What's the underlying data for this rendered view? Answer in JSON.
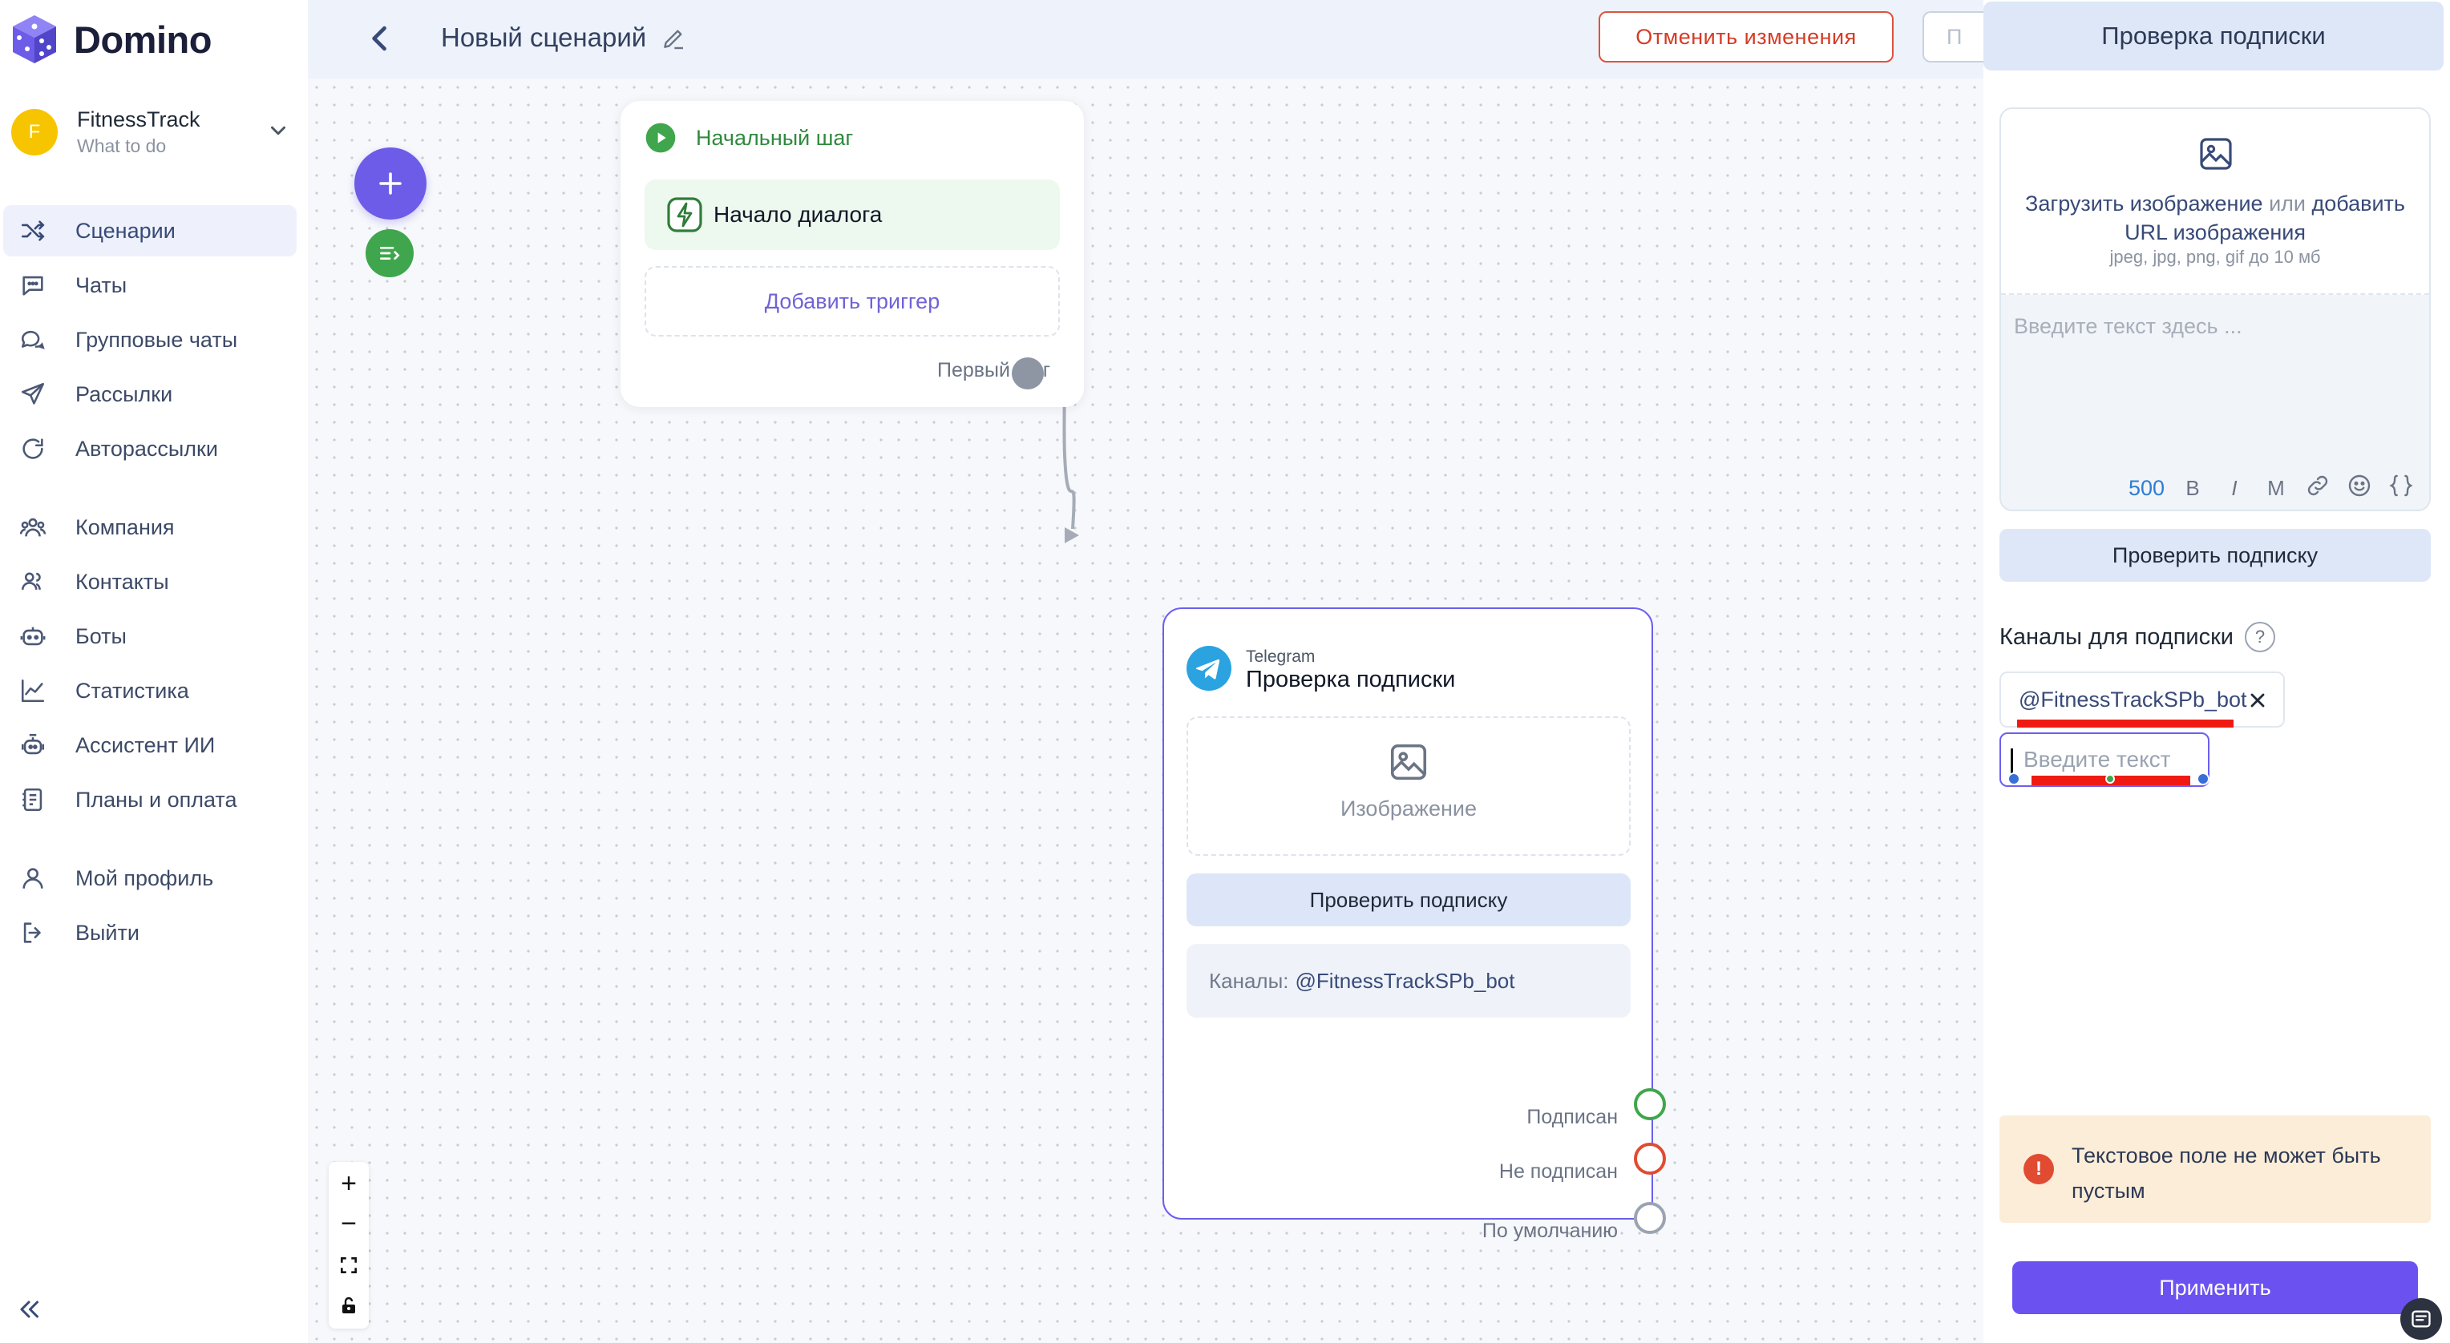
{
  "brand": {
    "name": "Domino",
    "logo_icon": "dice-cube-icon",
    "color": "#6c5ce7"
  },
  "workspace": {
    "avatar_letter": "F",
    "name": "FitnessTrack",
    "subtitle": "What to do"
  },
  "sidebar": {
    "items": [
      {
        "label": "Сценарии",
        "icon": "shuffle-icon",
        "active": true
      },
      {
        "label": "Чаты",
        "icon": "chat-icon"
      },
      {
        "label": "Групповые чаты",
        "icon": "group-chat-icon"
      },
      {
        "label": "Рассылки",
        "icon": "send-icon"
      },
      {
        "label": "Авторассылки",
        "icon": "auto-mail-icon"
      },
      {
        "label": "Компания",
        "icon": "company-icon"
      },
      {
        "label": "Контакты",
        "icon": "contacts-icon"
      },
      {
        "label": "Боты",
        "icon": "bot-icon"
      },
      {
        "label": "Статистика",
        "icon": "stats-icon"
      },
      {
        "label": "Ассистент ИИ",
        "icon": "ai-assistant-icon"
      },
      {
        "label": "Планы и оплата",
        "icon": "billing-icon"
      },
      {
        "label": "Мой профиль",
        "icon": "user-icon"
      },
      {
        "label": "Выйти",
        "icon": "logout-icon"
      }
    ]
  },
  "header": {
    "title": "Новый сценарий",
    "cancel_label": "Отменить изменения",
    "cut_label": "П"
  },
  "canvas": {
    "start_node": {
      "title": "Начальный шаг",
      "trigger_label": "Начало диалога",
      "add_trigger_label": "Добавить триггер",
      "output_label": "Первый шаг"
    },
    "check_node": {
      "platform": "Telegram",
      "title": "Проверка подписки",
      "image_label": "Изображение",
      "button_label": "Проверить подписку",
      "channels_key": "Каналы:",
      "channels_value": "@FitnessTrackSPb_bot",
      "outputs": [
        {
          "label": "Подписан",
          "color": "#3fa64d"
        },
        {
          "label": "Не подписан",
          "color": "#e04b32"
        },
        {
          "label": "По умолчанию",
          "color": "#9aa3b1"
        }
      ]
    },
    "zoom_controls": [
      "+",
      "−",
      "fit-icon",
      "lock-icon"
    ]
  },
  "panel": {
    "title": "Проверка подписки",
    "upload_link1": "Загрузить изображение",
    "upload_or": " или ",
    "upload_link2": "добавить",
    "upload_link3": "URL изображения",
    "upload_hint": "jpeg, jpg, png, gif до 10 мб",
    "text_placeholder": "Введите текст здесь ...",
    "char_counter": "500",
    "toolbar": [
      "B",
      "I",
      "M"
    ],
    "check_button_label": "Проверить подписку",
    "channels_title": "Каналы для подписки",
    "channel_chip": "@FitnessTrackSPb_bot",
    "channel_input_placeholder": "Введите текст",
    "error_text": "Текстовое поле не может быть пустым",
    "apply_label": "Применить"
  },
  "colors": {
    "accent": "#6b52f0",
    "error": "#e04b32",
    "success": "#3fa64d"
  }
}
